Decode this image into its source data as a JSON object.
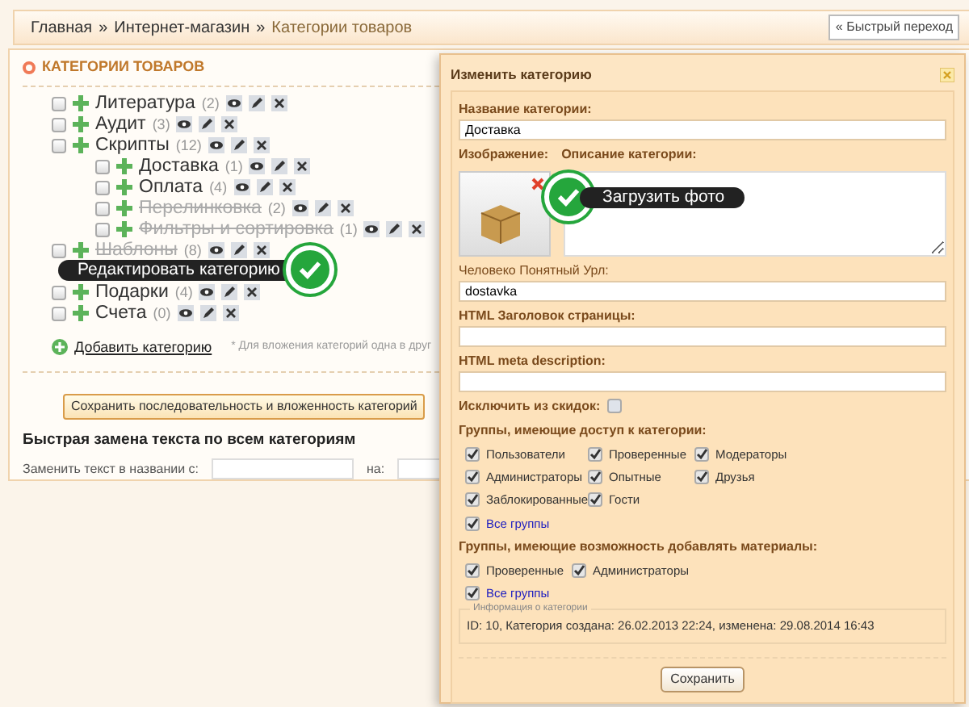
{
  "breadcrumb": [
    {
      "label": "Главная",
      "link": true
    },
    {
      "label": "Интернет-магазин",
      "link": true
    },
    {
      "label": "Категории товаров",
      "link": false
    }
  ],
  "breadcrumb_separator": "»",
  "quick_nav": "« Быстрый переход",
  "panel_title": "КАТЕГОРИИ ТОВАРОВ",
  "categories": [
    {
      "name": "Литература",
      "count": "(2)",
      "disabled": false,
      "checked": false
    },
    {
      "name": "Аудит",
      "count": "(3)",
      "disabled": false,
      "checked": false
    },
    {
      "name": "Скрипты",
      "count": "(12)",
      "disabled": false,
      "checked": false,
      "children": [
        {
          "name": "Доставка",
          "count": "(1)",
          "disabled": false,
          "checked": false
        },
        {
          "name": "Оплата",
          "count": "(4)",
          "disabled": false,
          "checked": false
        },
        {
          "name": "Перелинковка",
          "count": "(2)",
          "disabled": true,
          "checked": false
        },
        {
          "name": "Фильтры и сортировка",
          "count": "(1)",
          "disabled": true,
          "checked": false
        }
      ]
    },
    {
      "name": "Шаблоны",
      "count": "(8)",
      "disabled": true,
      "checked": false
    },
    {
      "name": "Подарки",
      "count": "(4)",
      "disabled": false,
      "checked": false
    },
    {
      "name": "Счета",
      "count": "(0)",
      "disabled": false,
      "checked": false
    }
  ],
  "edit_tooltip": "Редактировать категорию",
  "add_category": "Добавить категорию",
  "nesting_note": "* Для вложения категорий одна в друг",
  "save_order_button": "Сохранить последовательность и вложенность категорий",
  "replace": {
    "legend": "Быстрая замена текста по всем категориям",
    "from_label": "Заменить текст в названии с:",
    "to_label": "на:"
  },
  "dialog": {
    "title": "Изменить категорию",
    "name_label": "Название категории:",
    "name_value": "Доставка",
    "image_label": "Изображение:",
    "description_label": "Описание категории:",
    "upload_tooltip": "Загрузить фото",
    "url_label": "Человеко Понятный Урл:",
    "url_value": "dostavka",
    "html_title_label": "HTML Заголовок страницы:",
    "meta_label": "HTML meta description:",
    "exclude_label": "Исключить из скидок:",
    "exclude_checked": false,
    "access_label": "Группы, имеющие доступ к категории:",
    "access_groups": [
      {
        "label": "Пользователи",
        "checked": true,
        "kind": "group"
      },
      {
        "label": "Проверенные",
        "checked": true,
        "kind": "group"
      },
      {
        "label": "Модераторы",
        "checked": true,
        "kind": "group"
      },
      {
        "label": "Администраторы",
        "checked": true,
        "kind": "group"
      },
      {
        "label": "Опытные",
        "checked": true,
        "kind": "group"
      },
      {
        "label": "Друзья",
        "checked": true,
        "kind": "group"
      },
      {
        "label": "Заблокированные",
        "checked": true,
        "kind": "group"
      },
      {
        "label": "Гости",
        "checked": true,
        "kind": "group"
      },
      {
        "label": "Все группы",
        "checked": true,
        "kind": "all"
      }
    ],
    "add_label": "Группы, имеющие возможность добавлять материалы:",
    "add_groups": [
      {
        "label": "Проверенные",
        "checked": true,
        "kind": "group"
      },
      {
        "label": "Администраторы",
        "checked": true,
        "kind": "group"
      },
      {
        "label": "Все группы",
        "checked": true,
        "kind": "all"
      }
    ],
    "info_legend": "Информация о категории",
    "info_text": "ID: 10, Категория создана: 26.02.2013 22:24, изменена: 29.08.2014 16:43",
    "save_button": "Сохранить"
  }
}
